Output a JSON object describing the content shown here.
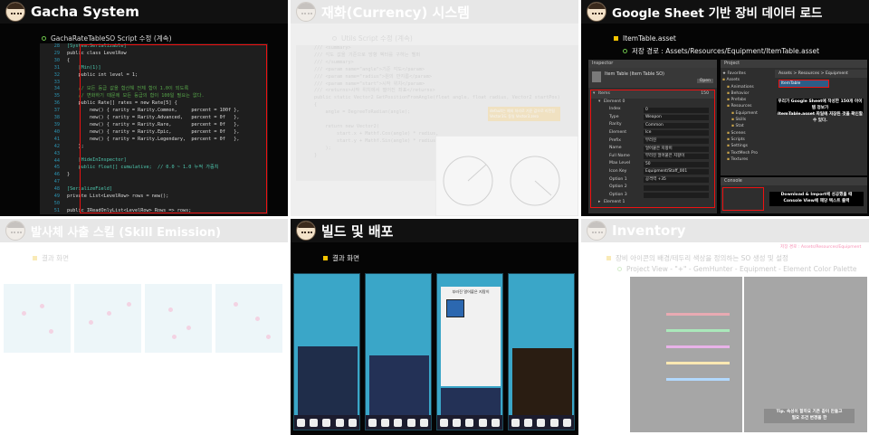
{
  "slides": [
    {
      "title": "Gacha System",
      "subtitle": "GachaRateTableSO Script 수정 (계속)",
      "line_numbers": [
        "28",
        "29",
        "30",
        "31",
        "32",
        "33",
        "34",
        "35",
        "36",
        "37",
        "38",
        "39",
        "40",
        "41",
        "42",
        "43",
        "44",
        "45",
        "46",
        "47",
        "48",
        "49",
        "50",
        "51",
        "52",
        "53",
        "54",
        "55",
        "56",
        "57",
        "58",
        "59",
        "60",
        "61",
        "62",
        "63",
        "64",
        "65"
      ],
      "code_lines": [
        "[System.Serializable]",
        "public class LevelRow",
        "{",
        "    [Min(1)]",
        "    public int level = 1;",
        "",
        "    // 모든 등급 값을 합산해 전체 합이 1.0이 되도록",
        "    // 변화하기 때문에 모든 등급의 합이 100일 필요는 없다.",
        "    public Rate[] rates = new Rate[5] {",
        "        new() { rarity = Rarity.Common,     percent = 100f },",
        "        new() { rarity = Rarity.Advanced,   percent = 0f   },",
        "        new() { rarity = Rarity.Rare,       percent = 0f   },",
        "        new() { rarity = Rarity.Epic,       percent = 0f   },",
        "        new() { rarity = Rarity.Legendary,  percent = 0f   },",
        "    };",
        "",
        "    [HideInInspector]",
        "    public float[] cumulative;  // 0.0 ~ 1.0 누적 가중치",
        "}",
        "",
        "[SerializeField]",
        "private List<LevelRow> rows = new();",
        "",
        "public IReadOnlyList<LevelRow> Rows => rows;"
      ]
    },
    {
      "title": "재화(Currency) 시스템",
      "subtitle": "Utils Script 수정 (계속)",
      "code_lines": [
        "/// <summary>",
        "/// 각도 값을 기준으로 방향 벡터를 구하는 헬퍼",
        "/// </summary>",
        "/// <param name=\"angle\">기준 각도</param>",
        "/// <param name=\"radius\">원의 반지름</param>",
        "/// <param name=\"start\">시작 위치</param>",
        "/// <returns>시작 위치에서 떨어진 좌표</returns>",
        "public static Vector2 GetPositionFromAngle(float angle, float radius, Vector2 startPos)",
        "{",
        "    angle = DegreeToRadian(angle);",
        "",
        "    return new Vector2(",
        "        start.x + Mathf.Cos(angle) * radius,",
        "        start.y + Mathf.Sin(angle) * radius",
        "    );",
        "}"
      ],
      "callout": [
        "default는 예외 처리로 기준 값으로 리턴됨",
        "Vector3도 동일 Vector3.zero"
      ]
    },
    {
      "title": "Google Sheet 기반 장비 데이터 로드",
      "bullet": "ItemTable.asset",
      "sub_bullet": "저장 경로 : Assets/Resources/Equipment/ItemTable.asset",
      "inspector": {
        "tab": "Inspector",
        "asset_title": "Item Table (Item Table SO)",
        "open_button": "Open",
        "items_label": "Items",
        "items_count": "150",
        "element_label": "Element 0",
        "fields": [
          {
            "label": "Index",
            "value": "0"
          },
          {
            "label": "Type",
            "value": "Weapon"
          },
          {
            "label": "Rarity",
            "value": "Common"
          },
          {
            "label": "Element",
            "value": "Ice"
          },
          {
            "label": "Prefix",
            "value": "부러진"
          },
          {
            "label": "Name",
            "value": "얼어붙은 지팡이"
          },
          {
            "label": "Full Name",
            "value": "부러진 얼어붙은 지팡이"
          },
          {
            "label": "Max Level",
            "value": "50"
          },
          {
            "label": "Icon Key",
            "value": "Equipment/Staff_001"
          },
          {
            "label": "Option 1",
            "value": "공격력 +35"
          },
          {
            "label": "Option 2",
            "value": ""
          },
          {
            "label": "Option 3",
            "value": ""
          }
        ],
        "element1": "Element 1"
      },
      "project": {
        "tab": "Project",
        "favorites": "Favorites",
        "breadcrumb": "Assets > Resources > Equipment",
        "selected_asset": "ItemTable",
        "tree": [
          "Assets",
          "Animations",
          "Behavior",
          "Prefabs",
          "Resources",
          "Equipment",
          "Skills",
          "Stat",
          "Scenes",
          "Scripts",
          "Settings",
          "TextMesh Pro",
          "Textures"
        ],
        "note": [
          "우리가 Google Sheet에 작성한 150개 아이템 정보가",
          "ItemTable.asset 파일에 저장된 것을 확인할 수 있다."
        ],
        "console_tab": "Console",
        "console_note": [
          "Download & Import에 성공했을 때",
          "Console View에 해당 텍스트 출력"
        ]
      }
    },
    {
      "title": "발사체 사출 스킬 (Skill Emission)",
      "bullet": "결과 화면"
    },
    {
      "title": "빌드 및 배포",
      "bullet": "결과 화면",
      "popup_title": "부러진 얼어붙은 지팡이"
    },
    {
      "title": "Inventory",
      "bullet": "장비 아이콘의 배경/테두리 색상을 정의하는 SO 생성 및 설정",
      "sub_bullet": "Project View - \"+\" - GemHunter - Equipment - Element Color Palette",
      "path_note": "저장 경로 : Assets/Resources/Equipment",
      "tip": [
        "Tip. 속성이 할까요 기존 같이 만들고",
        "필요 조건 변경을 한"
      ]
    }
  ],
  "colors": {
    "accent_yellow": "#f5c400",
    "accent_green": "#5fbf3f",
    "red_outline": "#e11111"
  }
}
